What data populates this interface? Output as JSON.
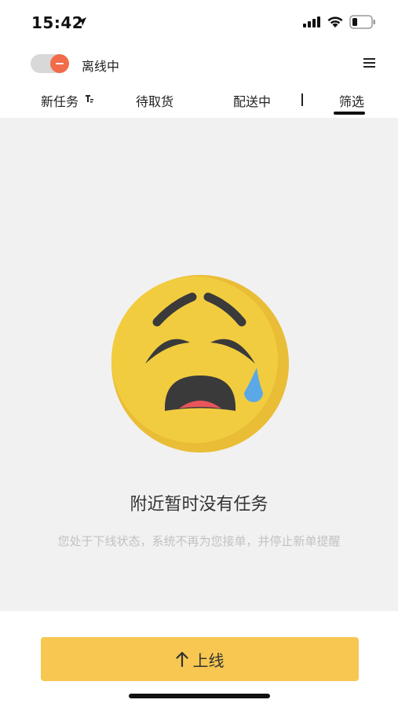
{
  "status_bar": {
    "time": "15:42"
  },
  "header": {
    "status_label": "离线中",
    "toggle_on": false
  },
  "tabs": [
    {
      "label": "新任务"
    },
    {
      "label": "待取货"
    },
    {
      "label": "配送中"
    },
    {
      "label": "筛选"
    }
  ],
  "empty_state": {
    "title": "附近暂时没有任务",
    "subtitle": "您处于下线状态，系统不再为您接单，并停止新单提醒"
  },
  "bottom": {
    "online_button_label": "上线"
  },
  "colors": {
    "accent": "#f7c752",
    "toggle_knob": "#f26b4a",
    "emoji_face": "#f2cc3f",
    "tear": "#5aa9e6"
  }
}
